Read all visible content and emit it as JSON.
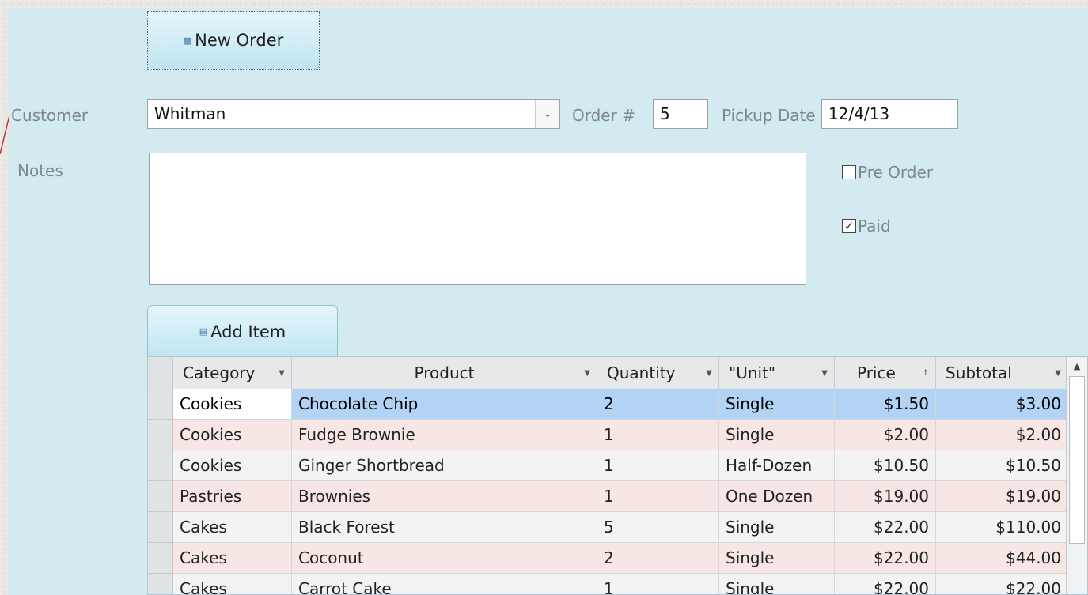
{
  "toolbar": {
    "new_order_label": "New Order",
    "add_item_label": "Add Item"
  },
  "form": {
    "customer_label": "Customer",
    "customer_value": "Whitman",
    "order_label": "Order #",
    "order_value": "5",
    "pickup_label": "Pickup Date",
    "pickup_value": "12/4/13",
    "notes_label": "Notes",
    "notes_value": "",
    "preorder_label": "Pre Order",
    "preorder_checked": false,
    "paid_label": "Paid",
    "paid_checked": true
  },
  "grid": {
    "columns": [
      "Category",
      "Product",
      "Quantity",
      "\"Unit\"",
      "Price",
      "Subtotal"
    ],
    "rows": [
      [
        "Cookies",
        "Chocolate Chip",
        "2",
        "Single",
        "$1.50",
        "$3.00"
      ],
      [
        "Cookies",
        "Fudge Brownie",
        "1",
        "Single",
        "$2.00",
        "$2.00"
      ],
      [
        "Cookies",
        "Ginger Shortbread",
        "1",
        "Half-Dozen",
        "$10.50",
        "$10.50"
      ],
      [
        "Pastries",
        "Brownies",
        "1",
        "One Dozen",
        "$19.00",
        "$19.00"
      ],
      [
        "Cakes",
        "Black Forest",
        "5",
        "Single",
        "$22.00",
        "$110.00"
      ],
      [
        "Cakes",
        "Coconut",
        "2",
        "Single",
        "$22.00",
        "$44.00"
      ],
      [
        "Cakes",
        "Carrot Cake",
        "1",
        "Single",
        "$22.00",
        "$22.00"
      ]
    ],
    "selected_row_index": 0
  },
  "colors": {
    "form_bg": "#d3eaf0",
    "selected_row": "#b3d3f5",
    "alt_row": "#f7e6e4",
    "plain_row": "#f3f3f3"
  },
  "icons": {
    "new_order": "new-record-icon",
    "add_item": "form-icon",
    "combo": "chevron-down-icon",
    "scroll_up": "scroll-up-arrow-icon"
  }
}
